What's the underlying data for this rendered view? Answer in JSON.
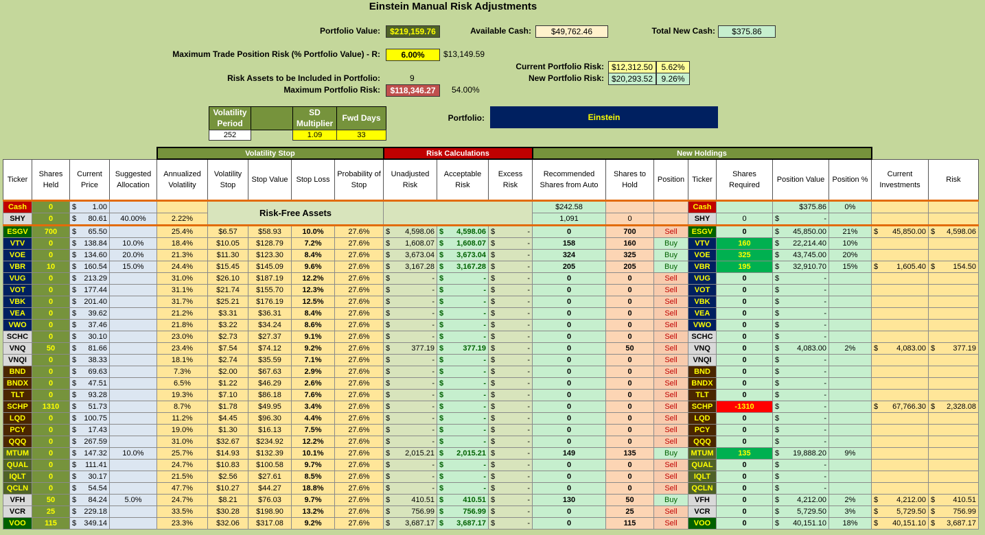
{
  "title": "Einstein Manual Risk Adjustments",
  "top": {
    "portfolio_value_label": "Portfolio Value:",
    "portfolio_value": "$219,159.76",
    "available_cash_label": "Available Cash:",
    "available_cash": "$49,762.46",
    "total_new_cash_label": "Total New Cash:",
    "total_new_cash": "$375.86",
    "max_trade_label": "Maximum Trade Position Risk (% Portfolio Value) - R:",
    "max_trade_pct": "6.00%",
    "max_trade_amt": "$13,149.59",
    "current_risk_label": "Current Portfolio Risk:",
    "current_risk": "$12,312.50",
    "current_risk_pct": "5.62%",
    "new_risk_label": "New Portfolio Risk:",
    "new_risk": "$20,293.52",
    "new_risk_pct": "9.26%",
    "risk_assets_label": "Risk Assets to be Included in Portfolio:",
    "risk_assets": "9",
    "max_portfolio_risk_label": "Maximum Portfolio Risk:",
    "max_portfolio_risk": "$118,346.27",
    "max_portfolio_risk_pct": "54.00%",
    "vol_period_label": "Volatility Period",
    "vol_period": "252",
    "sd_mult_label": "SD Multiplier",
    "sd_mult": "1.09",
    "fwd_days_label": "Fwd Days",
    "fwd_days": "33",
    "portfolio_label": "Portfolio:",
    "portfolio_name": "Einstein"
  },
  "groups": {
    "vol_stop": "Volatility Stop",
    "risk_calc": "Risk Calculations",
    "new_holdings": "New Holdings",
    "risk_free": "Risk-Free Assets"
  },
  "headers": [
    "Ticker",
    "Shares Held",
    "Current Price",
    "Suggested Allocation",
    "Annualized Volatility",
    "Volatility Stop",
    "Stop Value",
    "Stop Loss",
    "Probability of Stop",
    "Unadjusted Risk",
    "Acceptable Risk",
    "Excess Risk",
    "Recommended Shares from Auto",
    "Shares to Hold",
    "Position",
    "Ticker",
    "Shares Required",
    "Position Value",
    "Position %",
    "Current Investments",
    "Risk"
  ],
  "cash_row": {
    "ticker": "Cash",
    "shares": "0",
    "price": "1.00",
    "rec": "$242.58",
    "ticker2": "Cash",
    "value": "$375.86",
    "pct": "0%"
  },
  "shy_row": {
    "ticker": "SHY",
    "shares": "0",
    "price": "80.61",
    "alloc": "40.00%",
    "vol": "2.22%",
    "rec": "1,091",
    "hold": "0",
    "ticker2": "SHY",
    "req": "0",
    "value": "-"
  },
  "rows": [
    {
      "t": "ESGV",
      "cls": "tk-ow",
      "sh": "700",
      "pr": "65.50",
      "al": "",
      "vol": "25.4%",
      "vs": "$6.57",
      "sv": "$58.93",
      "sl": "10.0%",
      "ps": "27.6%",
      "ur": "4,598.06",
      "ar": "4,598.06",
      "er": "-",
      "rec": "0",
      "hold": "700",
      "pos": "Sell",
      "req": "0",
      "pv": "45,850.00",
      "pp": "21%",
      "ci": "45,850.00",
      "rk": "4,598.06"
    },
    {
      "t": "VTV",
      "cls": "tk",
      "sh": "0",
      "pr": "138.84",
      "al": "10.0%",
      "vol": "18.4%",
      "vs": "$10.05",
      "sv": "$128.79",
      "sl": "7.2%",
      "ps": "27.6%",
      "ur": "1,608.07",
      "ar": "1,608.07",
      "er": "-",
      "rec": "158",
      "hold": "160",
      "pos": "Buy",
      "req": "160",
      "pv": "22,214.40",
      "pp": "10%",
      "ci": "",
      "rk": ""
    },
    {
      "t": "VOE",
      "cls": "tk",
      "sh": "0",
      "pr": "134.60",
      "al": "20.0%",
      "vol": "21.3%",
      "vs": "$11.30",
      "sv": "$123.30",
      "sl": "8.4%",
      "ps": "27.6%",
      "ur": "3,673.04",
      "ar": "3,673.04",
      "er": "-",
      "rec": "324",
      "hold": "325",
      "pos": "Buy",
      "req": "325",
      "pv": "43,745.00",
      "pp": "20%",
      "ci": "",
      "rk": ""
    },
    {
      "t": "VBR",
      "cls": "tk",
      "sh": "10",
      "pr": "160.54",
      "al": "15.0%",
      "vol": "24.4%",
      "vs": "$15.45",
      "sv": "$145.09",
      "sl": "9.6%",
      "ps": "27.6%",
      "ur": "3,167.28",
      "ar": "3,167.28",
      "er": "-",
      "rec": "205",
      "hold": "205",
      "pos": "Buy",
      "req": "195",
      "pv": "32,910.70",
      "pp": "15%",
      "ci": "1,605.40",
      "rk": "154.50"
    },
    {
      "t": "VUG",
      "cls": "tk",
      "sh": "0",
      "pr": "213.29",
      "al": "",
      "vol": "31.0%",
      "vs": "$26.10",
      "sv": "$187.19",
      "sl": "12.2%",
      "ps": "27.6%",
      "ur": "-",
      "ar": "-",
      "er": "-",
      "rec": "0",
      "hold": "0",
      "pos": "Sell",
      "req": "0",
      "pv": "-",
      "pp": "",
      "ci": "",
      "rk": ""
    },
    {
      "t": "VOT",
      "cls": "tk",
      "sh": "0",
      "pr": "177.44",
      "al": "",
      "vol": "31.1%",
      "vs": "$21.74",
      "sv": "$155.70",
      "sl": "12.3%",
      "ps": "27.6%",
      "ur": "-",
      "ar": "-",
      "er": "-",
      "rec": "0",
      "hold": "0",
      "pos": "Sell",
      "req": "0",
      "pv": "-",
      "pp": "",
      "ci": "",
      "rk": ""
    },
    {
      "t": "VBK",
      "cls": "tk",
      "sh": "0",
      "pr": "201.40",
      "al": "",
      "vol": "31.7%",
      "vs": "$25.21",
      "sv": "$176.19",
      "sl": "12.5%",
      "ps": "27.6%",
      "ur": "-",
      "ar": "-",
      "er": "-",
      "rec": "0",
      "hold": "0",
      "pos": "Sell",
      "req": "0",
      "pv": "-",
      "pp": "",
      "ci": "",
      "rk": ""
    },
    {
      "t": "VEA",
      "cls": "tk",
      "sh": "0",
      "pr": "39.62",
      "al": "",
      "vol": "21.2%",
      "vs": "$3.31",
      "sv": "$36.31",
      "sl": "8.4%",
      "ps": "27.6%",
      "ur": "-",
      "ar": "-",
      "er": "-",
      "rec": "0",
      "hold": "0",
      "pos": "Sell",
      "req": "0",
      "pv": "-",
      "pp": "",
      "ci": "",
      "rk": ""
    },
    {
      "t": "VWO",
      "cls": "tk",
      "sh": "0",
      "pr": "37.46",
      "al": "",
      "vol": "21.8%",
      "vs": "$3.22",
      "sv": "$34.24",
      "sl": "8.6%",
      "ps": "27.6%",
      "ur": "-",
      "ar": "-",
      "er": "-",
      "rec": "0",
      "hold": "0",
      "pos": "Sell",
      "req": "0",
      "pv": "-",
      "pp": "",
      "ci": "",
      "rk": ""
    },
    {
      "t": "SCHC",
      "cls": "tk-gy",
      "sh": "0",
      "pr": "30.10",
      "al": "",
      "vol": "23.0%",
      "vs": "$2.73",
      "sv": "$27.37",
      "sl": "9.1%",
      "ps": "27.6%",
      "ur": "-",
      "ar": "-",
      "er": "-",
      "rec": "0",
      "hold": "0",
      "pos": "Sell",
      "req": "0",
      "pv": "-",
      "pp": "",
      "ci": "",
      "rk": ""
    },
    {
      "t": "VNQ",
      "cls": "tk-gy",
      "sh": "50",
      "pr": "81.66",
      "al": "",
      "vol": "23.4%",
      "vs": "$7.54",
      "sv": "$74.12",
      "sl": "9.2%",
      "ps": "27.6%",
      "ur": "377.19",
      "ar": "377.19",
      "er": "-",
      "rec": "0",
      "hold": "50",
      "pos": "Sell",
      "req": "0",
      "pv": "4,083.00",
      "pp": "2%",
      "ci": "4,083.00",
      "rk": "377.19"
    },
    {
      "t": "VNQI",
      "cls": "tk-gy",
      "sh": "0",
      "pr": "38.33",
      "al": "",
      "vol": "18.1%",
      "vs": "$2.74",
      "sv": "$35.59",
      "sl": "7.1%",
      "ps": "27.6%",
      "ur": "-",
      "ar": "-",
      "er": "-",
      "rec": "0",
      "hold": "0",
      "pos": "Sell",
      "req": "0",
      "pv": "-",
      "pp": "",
      "ci": "",
      "rk": ""
    },
    {
      "t": "BND",
      "cls": "tk-br",
      "sh": "0",
      "pr": "69.63",
      "al": "",
      "vol": "7.3%",
      "vs": "$2.00",
      "sv": "$67.63",
      "sl": "2.9%",
      "ps": "27.6%",
      "ur": "-",
      "ar": "-",
      "er": "-",
      "rec": "0",
      "hold": "0",
      "pos": "Sell",
      "req": "0",
      "pv": "-",
      "pp": "",
      "ci": "",
      "rk": ""
    },
    {
      "t": "BNDX",
      "cls": "tk-br",
      "sh": "0",
      "pr": "47.51",
      "al": "",
      "vol": "6.5%",
      "vs": "$1.22",
      "sv": "$46.29",
      "sl": "2.6%",
      "ps": "27.6%",
      "ur": "-",
      "ar": "-",
      "er": "-",
      "rec": "0",
      "hold": "0",
      "pos": "Sell",
      "req": "0",
      "pv": "-",
      "pp": "",
      "ci": "",
      "rk": ""
    },
    {
      "t": "TLT",
      "cls": "tk-br",
      "sh": "0",
      "pr": "93.28",
      "al": "",
      "vol": "19.3%",
      "vs": "$7.10",
      "sv": "$86.18",
      "sl": "7.6%",
      "ps": "27.6%",
      "ur": "-",
      "ar": "-",
      "er": "-",
      "rec": "0",
      "hold": "0",
      "pos": "Sell",
      "req": "0",
      "pv": "-",
      "pp": "",
      "ci": "",
      "rk": ""
    },
    {
      "t": "SCHP",
      "cls": "tk-br",
      "sh": "1310",
      "pr": "51.73",
      "al": "",
      "vol": "8.7%",
      "vs": "$1.78",
      "sv": "$49.95",
      "sl": "3.4%",
      "ps": "27.6%",
      "ur": "-",
      "ar": "-",
      "er": "-",
      "rec": "0",
      "hold": "0",
      "pos": "Sell",
      "req": "-1310",
      "pv": "-",
      "pp": "",
      "ci": "67,766.30",
      "rk": "2,328.08"
    },
    {
      "t": "LQD",
      "cls": "tk-br",
      "sh": "0",
      "pr": "100.75",
      "al": "",
      "vol": "11.2%",
      "vs": "$4.45",
      "sv": "$96.30",
      "sl": "4.4%",
      "ps": "27.6%",
      "ur": "-",
      "ar": "-",
      "er": "-",
      "rec": "0",
      "hold": "0",
      "pos": "Sell",
      "req": "0",
      "pv": "-",
      "pp": "",
      "ci": "",
      "rk": ""
    },
    {
      "t": "PCY",
      "cls": "tk-br",
      "sh": "0",
      "pr": "17.43",
      "al": "",
      "vol": "19.0%",
      "vs": "$1.30",
      "sv": "$16.13",
      "sl": "7.5%",
      "ps": "27.6%",
      "ur": "-",
      "ar": "-",
      "er": "-",
      "rec": "0",
      "hold": "0",
      "pos": "Sell",
      "req": "0",
      "pv": "-",
      "pp": "",
      "ci": "",
      "rk": ""
    },
    {
      "t": "QQQ",
      "cls": "tk-br",
      "sh": "0",
      "pr": "267.59",
      "al": "",
      "vol": "31.0%",
      "vs": "$32.67",
      "sv": "$234.92",
      "sl": "12.2%",
      "ps": "27.6%",
      "ur": "-",
      "ar": "-",
      "er": "-",
      "rec": "0",
      "hold": "0",
      "pos": "Sell",
      "req": "0",
      "pv": "-",
      "pp": "",
      "ci": "",
      "rk": ""
    },
    {
      "t": "MTUM",
      "cls": "tk-ol",
      "sh": "0",
      "pr": "147.32",
      "al": "10.0%",
      "vol": "25.7%",
      "vs": "$14.93",
      "sv": "$132.39",
      "sl": "10.1%",
      "ps": "27.6%",
      "ur": "2,015.21",
      "ar": "2,015.21",
      "er": "-",
      "rec": "149",
      "hold": "135",
      "pos": "Buy",
      "req": "135",
      "pv": "19,888.20",
      "pp": "9%",
      "ci": "",
      "rk": ""
    },
    {
      "t": "QUAL",
      "cls": "tk-ol",
      "sh": "0",
      "pr": "111.41",
      "al": "",
      "vol": "24.7%",
      "vs": "$10.83",
      "sv": "$100.58",
      "sl": "9.7%",
      "ps": "27.6%",
      "ur": "-",
      "ar": "-",
      "er": "-",
      "rec": "0",
      "hold": "0",
      "pos": "Sell",
      "req": "0",
      "pv": "-",
      "pp": "",
      "ci": "",
      "rk": ""
    },
    {
      "t": "IQLT",
      "cls": "tk-ol",
      "sh": "0",
      "pr": "30.17",
      "al": "",
      "vol": "21.5%",
      "vs": "$2.56",
      "sv": "$27.61",
      "sl": "8.5%",
      "ps": "27.6%",
      "ur": "-",
      "ar": "-",
      "er": "-",
      "rec": "0",
      "hold": "0",
      "pos": "Sell",
      "req": "0",
      "pv": "-",
      "pp": "",
      "ci": "",
      "rk": ""
    },
    {
      "t": "QCLN",
      "cls": "tk-ol",
      "sh": "0",
      "pr": "54.54",
      "al": "",
      "vol": "47.7%",
      "vs": "$10.27",
      "sv": "$44.27",
      "sl": "18.8%",
      "ps": "27.6%",
      "ur": "-",
      "ar": "-",
      "er": "-",
      "rec": "0",
      "hold": "0",
      "pos": "Sell",
      "req": "0",
      "pv": "-",
      "pp": "",
      "ci": "",
      "rk": ""
    },
    {
      "t": "VFH",
      "cls": "tk-gy",
      "sh": "50",
      "pr": "84.24",
      "al": "5.0%",
      "vol": "24.7%",
      "vs": "$8.21",
      "sv": "$76.03",
      "sl": "9.7%",
      "ps": "27.6%",
      "ur": "410.51",
      "ar": "410.51",
      "er": "-",
      "rec": "130",
      "hold": "50",
      "pos": "Buy",
      "req": "0",
      "pv": "4,212.00",
      "pp": "2%",
      "ci": "4,212.00",
      "rk": "410.51"
    },
    {
      "t": "VCR",
      "cls": "tk-gy",
      "sh": "25",
      "pr": "229.18",
      "al": "",
      "vol": "33.5%",
      "vs": "$30.28",
      "sv": "$198.90",
      "sl": "13.2%",
      "ps": "27.6%",
      "ur": "756.99",
      "ar": "756.99",
      "er": "-",
      "rec": "0",
      "hold": "25",
      "pos": "Sell",
      "req": "0",
      "pv": "5,729.50",
      "pp": "3%",
      "ci": "5,729.50",
      "rk": "756.99"
    },
    {
      "t": "VOO",
      "cls": "tk-ow",
      "sh": "115",
      "pr": "349.14",
      "al": "",
      "vol": "23.3%",
      "vs": "$32.06",
      "sv": "$317.08",
      "sl": "9.2%",
      "ps": "27.6%",
      "ur": "3,687.17",
      "ar": "3,687.17",
      "er": "-",
      "rec": "0",
      "hold": "115",
      "pos": "Sell",
      "req": "0",
      "pv": "40,151.10",
      "pp": "18%",
      "ci": "40,151.10",
      "rk": "3,687.17"
    }
  ],
  "colors": {
    "background": "#c4d79b",
    "ticker_navy": "#002060",
    "header_green": "#76933c",
    "header_red": "#c00000"
  }
}
